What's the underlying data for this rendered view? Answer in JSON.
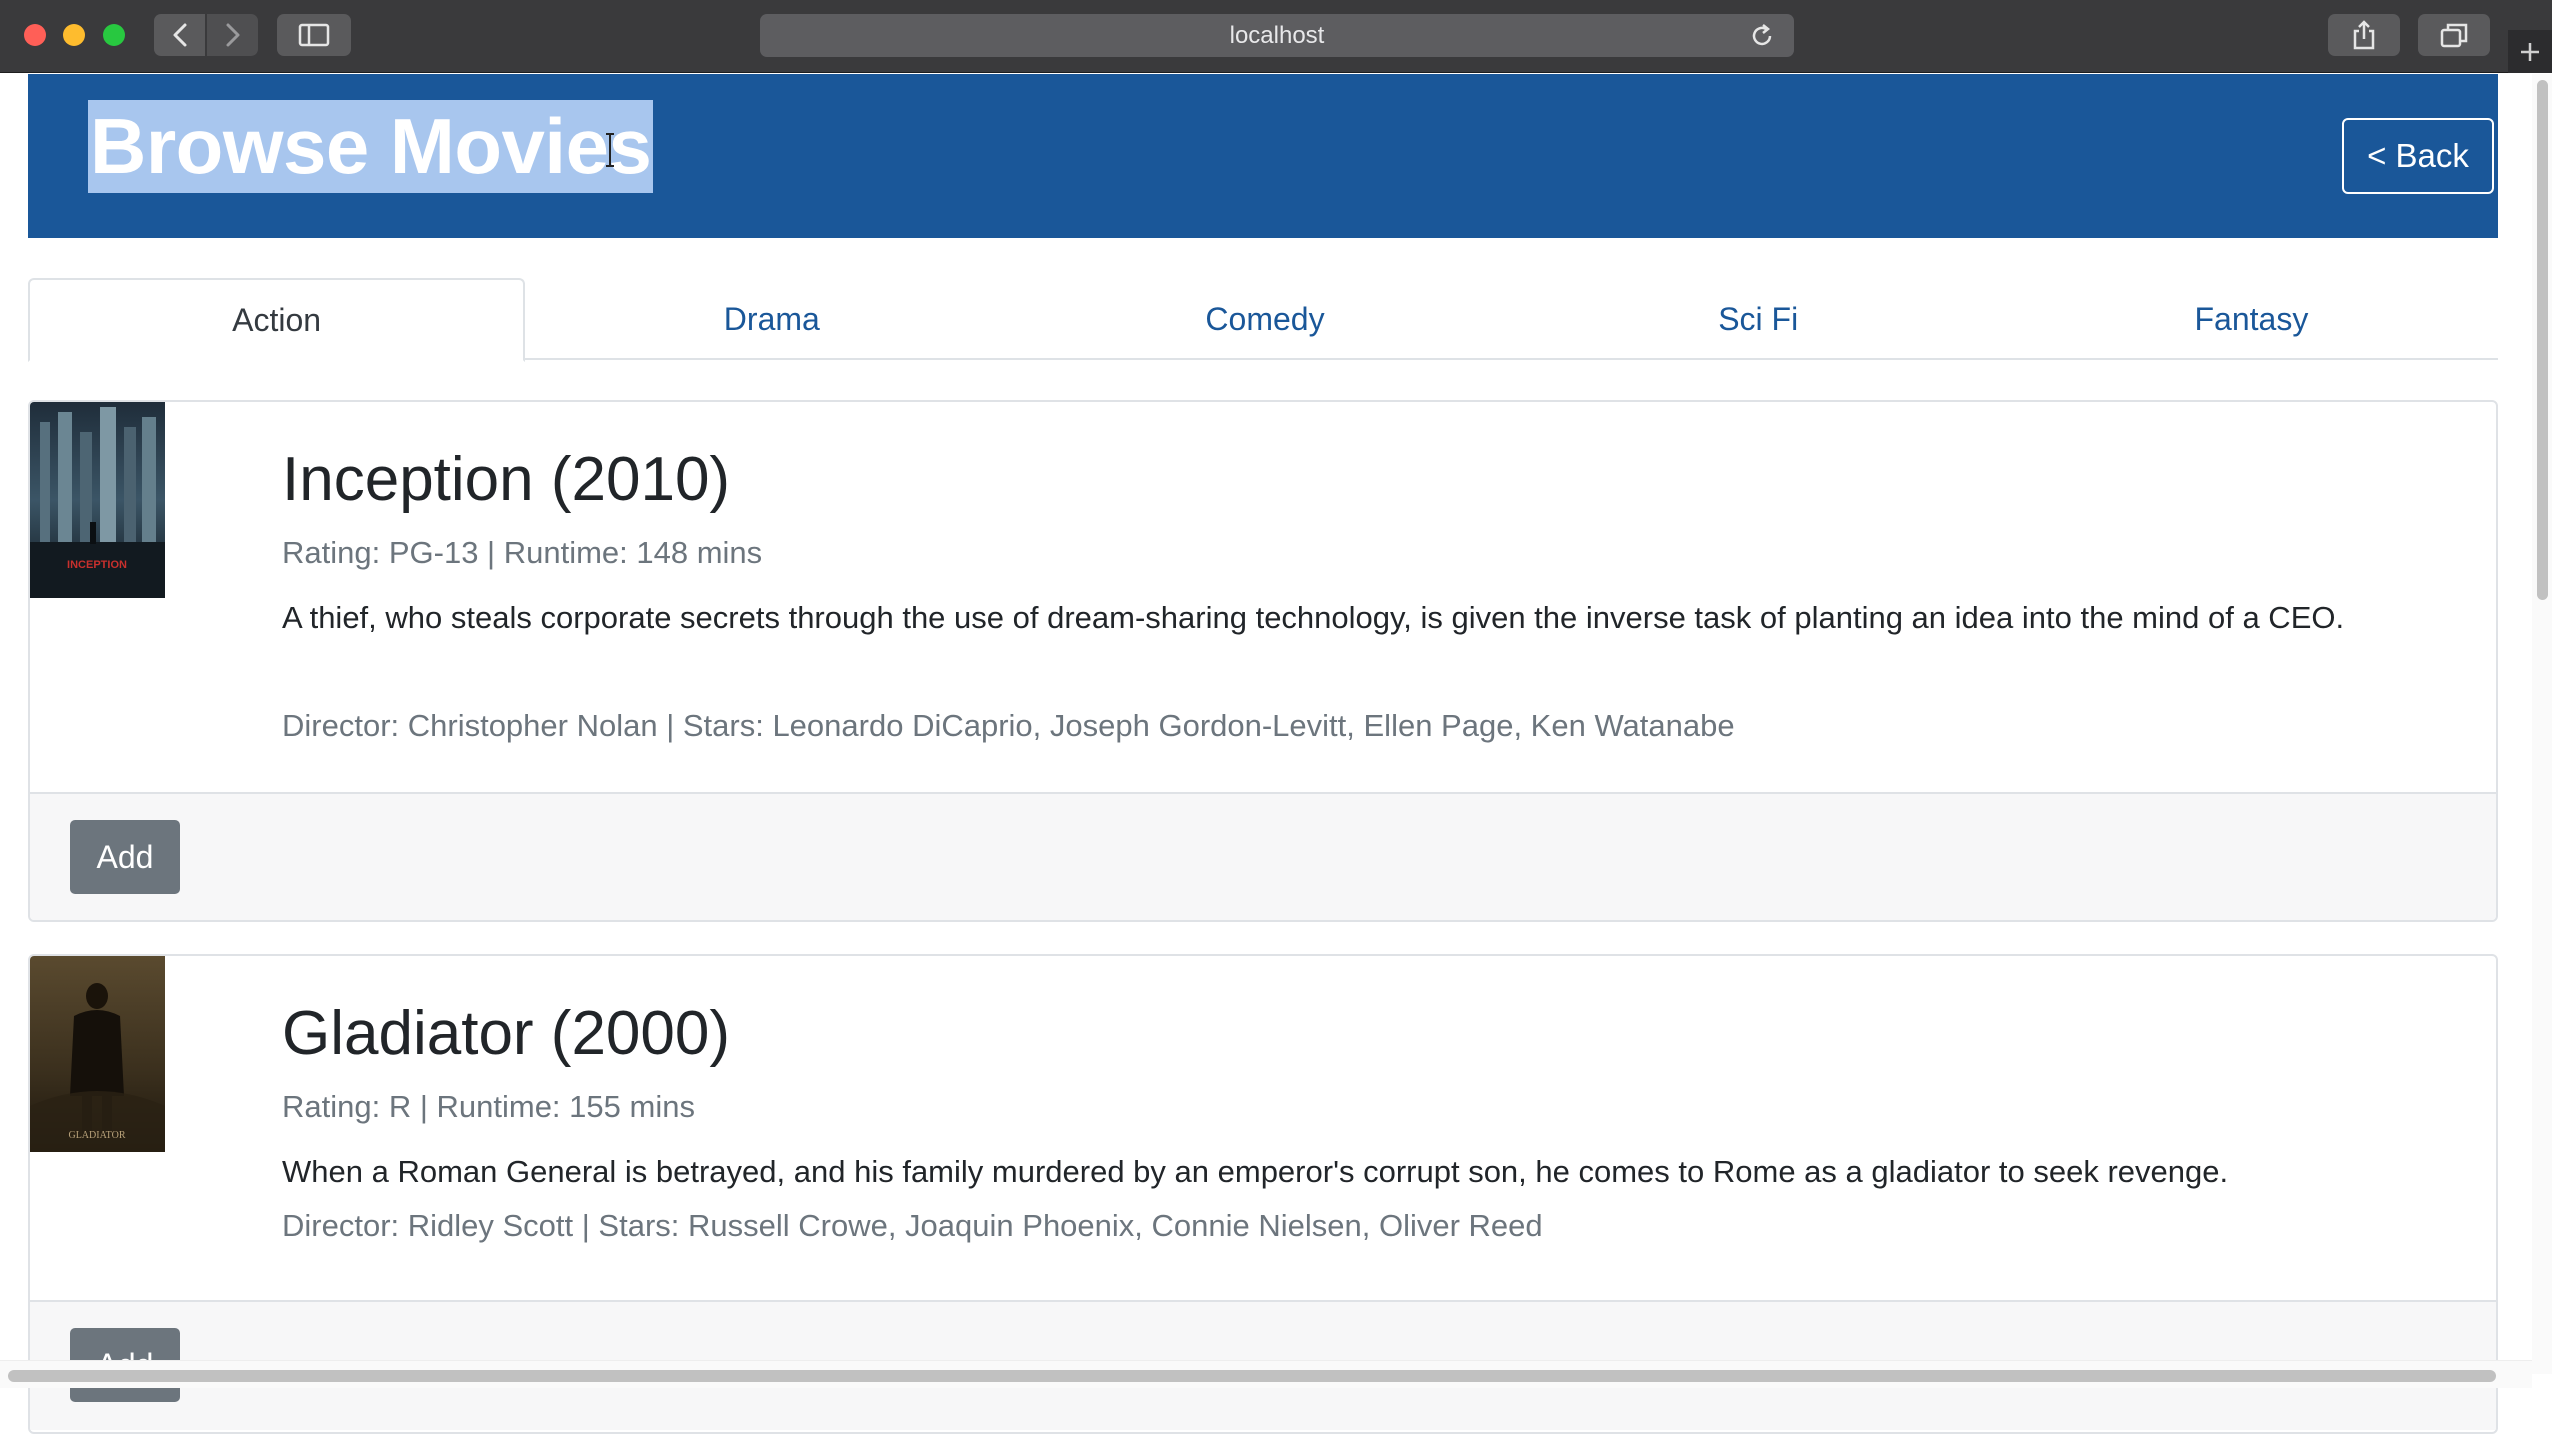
{
  "browser": {
    "url": "localhost",
    "icons": {
      "back": "chevron-left-icon",
      "forward": "chevron-right-icon",
      "sidebar": "sidebar-icon",
      "reload": "reload-icon",
      "share": "share-icon",
      "tabs": "tabs-overview-icon",
      "new_tab": "plus-icon"
    }
  },
  "header": {
    "title": "Browse Movies",
    "back_label": "< Back",
    "background": "#1a5799"
  },
  "tabs": [
    {
      "label": "Action",
      "active": true
    },
    {
      "label": "Drama",
      "active": false
    },
    {
      "label": "Comedy",
      "active": false
    },
    {
      "label": "Sci Fi",
      "active": false
    },
    {
      "label": "Fantasy",
      "active": false
    }
  ],
  "movies": [
    {
      "title": "Inception (2010)",
      "meta": "Rating: PG-13 | Runtime: 148 mins",
      "description": "A thief, who steals corporate secrets through the use of dream-sharing technology, is given the inverse task of planting an idea into the mind of a CEO.",
      "credits": "Director: Christopher Nolan | Stars: Leonardo DiCaprio, Joseph Gordon-Levitt, Ellen Page, Ken Watanabe",
      "poster_text": "INCEPTION",
      "add_label": "Add"
    },
    {
      "title": "Gladiator (2000)",
      "meta": "Rating: R | Runtime: 155 mins",
      "description": "When a Roman General is betrayed, and his family murdered by an emperor's corrupt son, he comes to Rome as a gladiator to seek revenge.",
      "credits": "Director: Ridley Scott | Stars: Russell Crowe, Joaquin Phoenix, Connie Nielsen, Oliver Reed",
      "poster_text": "GLADIATOR",
      "add_label": "Add"
    }
  ]
}
